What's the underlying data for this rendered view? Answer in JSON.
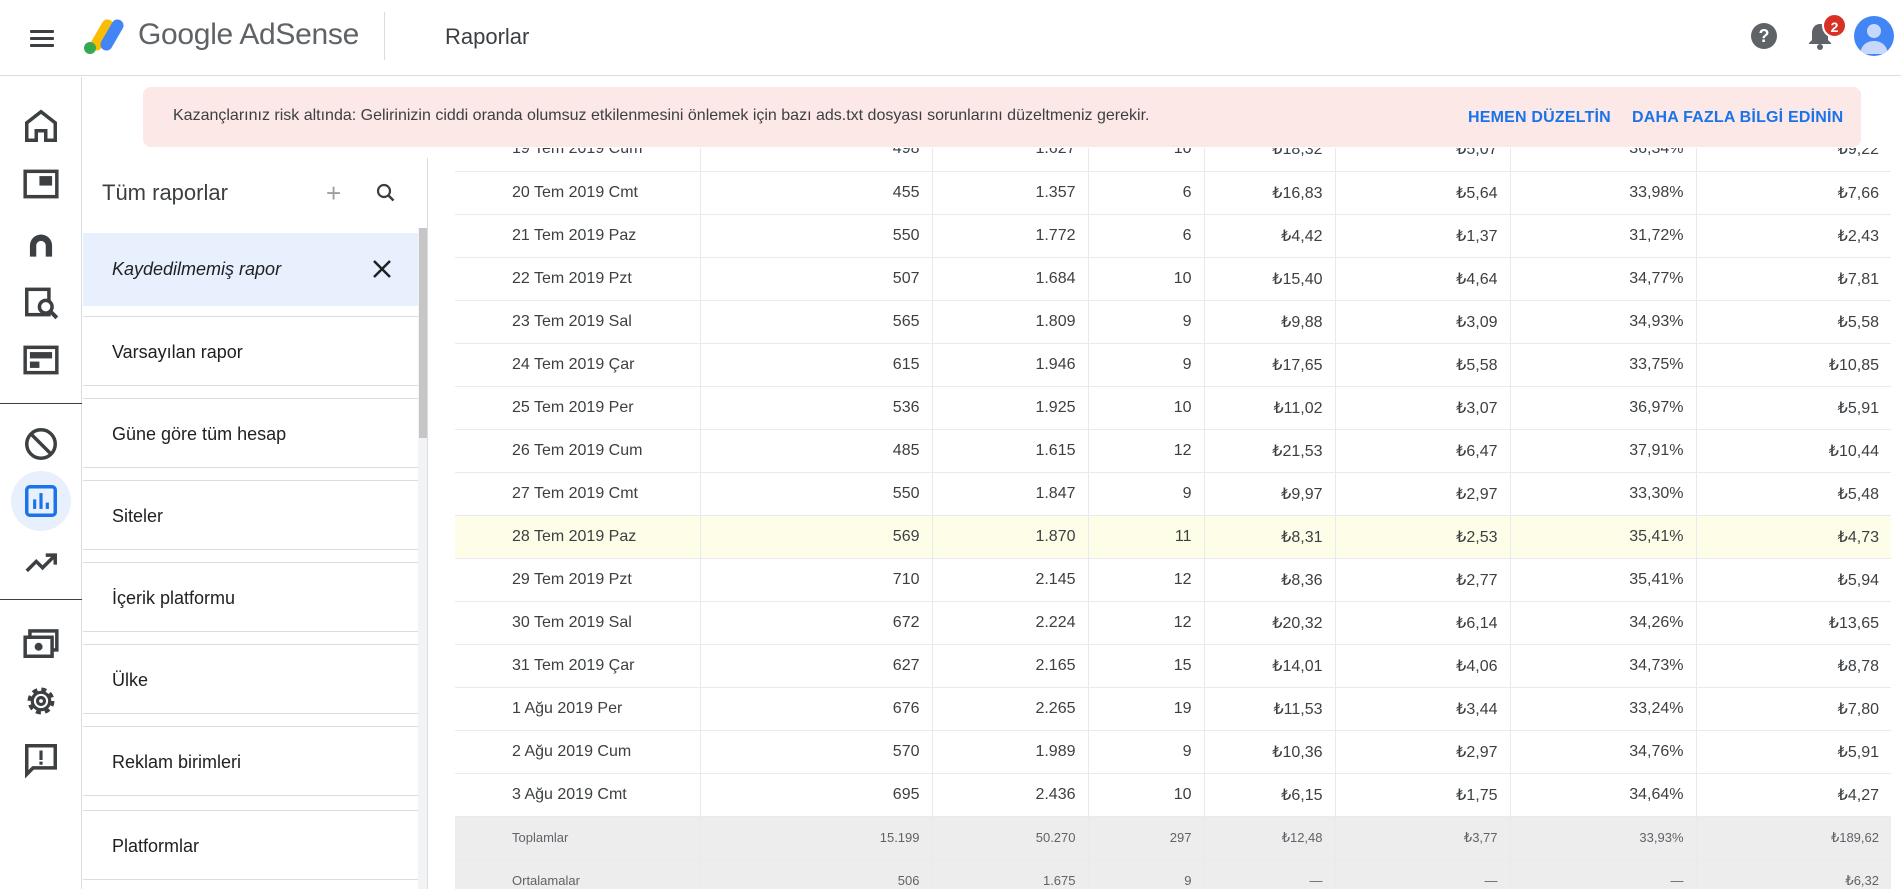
{
  "header": {
    "brand": "Google AdSense",
    "page_title": "Raporlar",
    "notification_count": "2"
  },
  "banner": {
    "message": "Kazançlarınız risk altında: Gelirinizin ciddi oranda olumsuz etkilenmesini önlemek için bazı ads.txt dosyası sorunlarını düzeltmeniz gerekir.",
    "fix_now": "HEMEN DÜZELTİN",
    "learn_more": "DAHA FAZLA BİLGİ EDİNİN"
  },
  "left_rail": {
    "icons": [
      "home-icon",
      "ads-icon",
      "sites-icon",
      "optimization-icon",
      "blocking-controls-icon",
      "block-icon",
      "reports-icon",
      "trending-icon",
      "payments-icon",
      "settings-icon",
      "feedback-icon"
    ],
    "active": "reports-icon"
  },
  "reports": {
    "title": "Tüm raporlar",
    "current": "Kaydedilmemiş rapor",
    "items": [
      "Varsayılan rapor",
      "Güne göre tüm hesap",
      "Siteler",
      "İçerik platformu",
      "Ülke",
      "Reklam birimleri",
      "Platformlar"
    ]
  },
  "table": {
    "rows": [
      [
        "19 Tem 2019 Cum",
        "498",
        "1.627",
        "10",
        "₺18,32",
        "₺5,07",
        "36,34%",
        "₺9,22"
      ],
      [
        "20 Tem 2019 Cmt",
        "455",
        "1.357",
        "6",
        "₺16,83",
        "₺5,64",
        "33,98%",
        "₺7,66"
      ],
      [
        "21 Tem 2019 Paz",
        "550",
        "1.772",
        "6",
        "₺4,42",
        "₺1,37",
        "31,72%",
        "₺2,43"
      ],
      [
        "22 Tem 2019 Pzt",
        "507",
        "1.684",
        "10",
        "₺15,40",
        "₺4,64",
        "34,77%",
        "₺7,81"
      ],
      [
        "23 Tem 2019 Sal",
        "565",
        "1.809",
        "9",
        "₺9,88",
        "₺3,09",
        "34,93%",
        "₺5,58"
      ],
      [
        "24 Tem 2019 Çar",
        "615",
        "1.946",
        "9",
        "₺17,65",
        "₺5,58",
        "33,75%",
        "₺10,85"
      ],
      [
        "25 Tem 2019 Per",
        "536",
        "1.925",
        "10",
        "₺11,02",
        "₺3,07",
        "36,97%",
        "₺5,91"
      ],
      [
        "26 Tem 2019 Cum",
        "485",
        "1.615",
        "12",
        "₺21,53",
        "₺6,47",
        "37,91%",
        "₺10,44"
      ],
      [
        "27 Tem 2019 Cmt",
        "550",
        "1.847",
        "9",
        "₺9,97",
        "₺2,97",
        "33,30%",
        "₺5,48"
      ],
      [
        "28 Tem 2019 Paz",
        "569",
        "1.870",
        "11",
        "₺8,31",
        "₺2,53",
        "35,41%",
        "₺4,73"
      ],
      [
        "29 Tem 2019 Pzt",
        "710",
        "2.145",
        "12",
        "₺8,36",
        "₺2,77",
        "35,41%",
        "₺5,94"
      ],
      [
        "30 Tem 2019 Sal",
        "672",
        "2.224",
        "12",
        "₺20,32",
        "₺6,14",
        "34,26%",
        "₺13,65"
      ],
      [
        "31 Tem 2019 Çar",
        "627",
        "2.165",
        "15",
        "₺14,01",
        "₺4,06",
        "34,73%",
        "₺8,78"
      ],
      [
        "1 Ağu 2019 Per",
        "676",
        "2.265",
        "19",
        "₺11,53",
        "₺3,44",
        "33,24%",
        "₺7,80"
      ],
      [
        "2 Ağu 2019 Cum",
        "570",
        "1.989",
        "9",
        "₺10,36",
        "₺2,97",
        "34,76%",
        "₺5,91"
      ],
      [
        "3 Ağu 2019 Cmt",
        "695",
        "2.436",
        "10",
        "₺6,15",
        "₺1,75",
        "34,64%",
        "₺4,27"
      ]
    ],
    "highlighted_row": "28 Tem 2019 Paz",
    "totals": [
      "Toplamlar",
      "15.199",
      "50.270",
      "297",
      "₺12,48",
      "₺3,77",
      "33,93%",
      "₺189,62"
    ],
    "averages": [
      "Ortalamalar",
      "506",
      "1.675",
      "9",
      "—",
      "—",
      "—",
      "₺6,32"
    ]
  },
  "colors": {
    "accent": "#1a73e8",
    "banner_bg": "#fce8e6",
    "badge": "#d93025",
    "highlight_row": "#fefee8"
  }
}
